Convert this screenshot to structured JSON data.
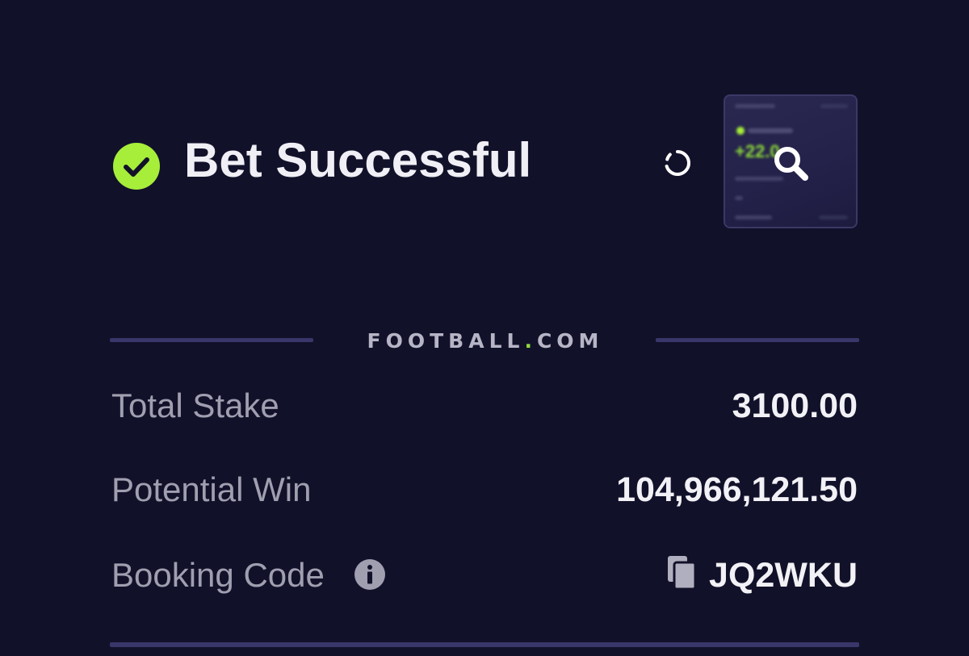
{
  "header": {
    "title": "Bet Successful",
    "status_icon": "check-circle-icon",
    "accent_color": "#a6ee3a"
  },
  "thumbnail": {
    "preview_amount": "+22.0",
    "icon": "search-icon"
  },
  "brand": {
    "name_left": "FOOTBALL",
    "dot": ".",
    "name_right": "COM",
    "dot_color": "#8fdc3a"
  },
  "summary": {
    "total_stake_label": "Total Stake",
    "total_stake_value": "3100.00",
    "potential_win_label": "Potential Win",
    "potential_win_value": "104,966,121.50",
    "booking_code_label": "Booking Code",
    "booking_code_value": "JQ2WKU"
  },
  "colors": {
    "background": "#12112a",
    "divider": "#39366a",
    "label": "#a09fb0",
    "value": "#f1f1f6"
  }
}
